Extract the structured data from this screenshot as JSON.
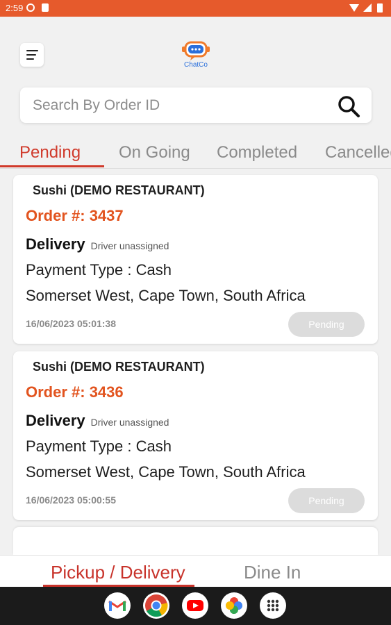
{
  "status_bar": {
    "time": "2:59"
  },
  "app": {
    "logo_text": "ChatCo"
  },
  "search": {
    "placeholder": "Search By Order ID"
  },
  "tabs": [
    {
      "label": "Pending",
      "active": true
    },
    {
      "label": "On Going",
      "active": false
    },
    {
      "label": "Completed",
      "active": false
    },
    {
      "label": "Cancelled",
      "active": false
    }
  ],
  "orders": [
    {
      "restaurant": "Sushi (DEMO RESTAURANT)",
      "order_number": "Order #: 3437",
      "type": "Delivery",
      "driver_status": "Driver unassigned",
      "payment": "Payment Type : Cash",
      "address": "Somerset West, Cape Town, South Africa",
      "datetime": "16/06/2023 05:01:38",
      "status": "Pending"
    },
    {
      "restaurant": "Sushi (DEMO RESTAURANT)",
      "order_number": "Order #: 3436",
      "type": "Delivery",
      "driver_status": "Driver unassigned",
      "payment": "Payment Type : Cash",
      "address": "Somerset West, Cape Town, South Africa",
      "datetime": "16/06/2023 05:00:55",
      "status": "Pending"
    }
  ],
  "bottom_tabs": [
    {
      "label": "Pickup / Delivery",
      "active": true
    },
    {
      "label": "Dine In",
      "active": false
    }
  ],
  "dock": [
    "gmail-icon",
    "chrome-icon",
    "youtube-icon",
    "photos-icon",
    "app-drawer-icon"
  ],
  "colors": {
    "accent": "#e65a2c",
    "order_number": "#e2541f",
    "active_tab": "#d03a2b"
  }
}
